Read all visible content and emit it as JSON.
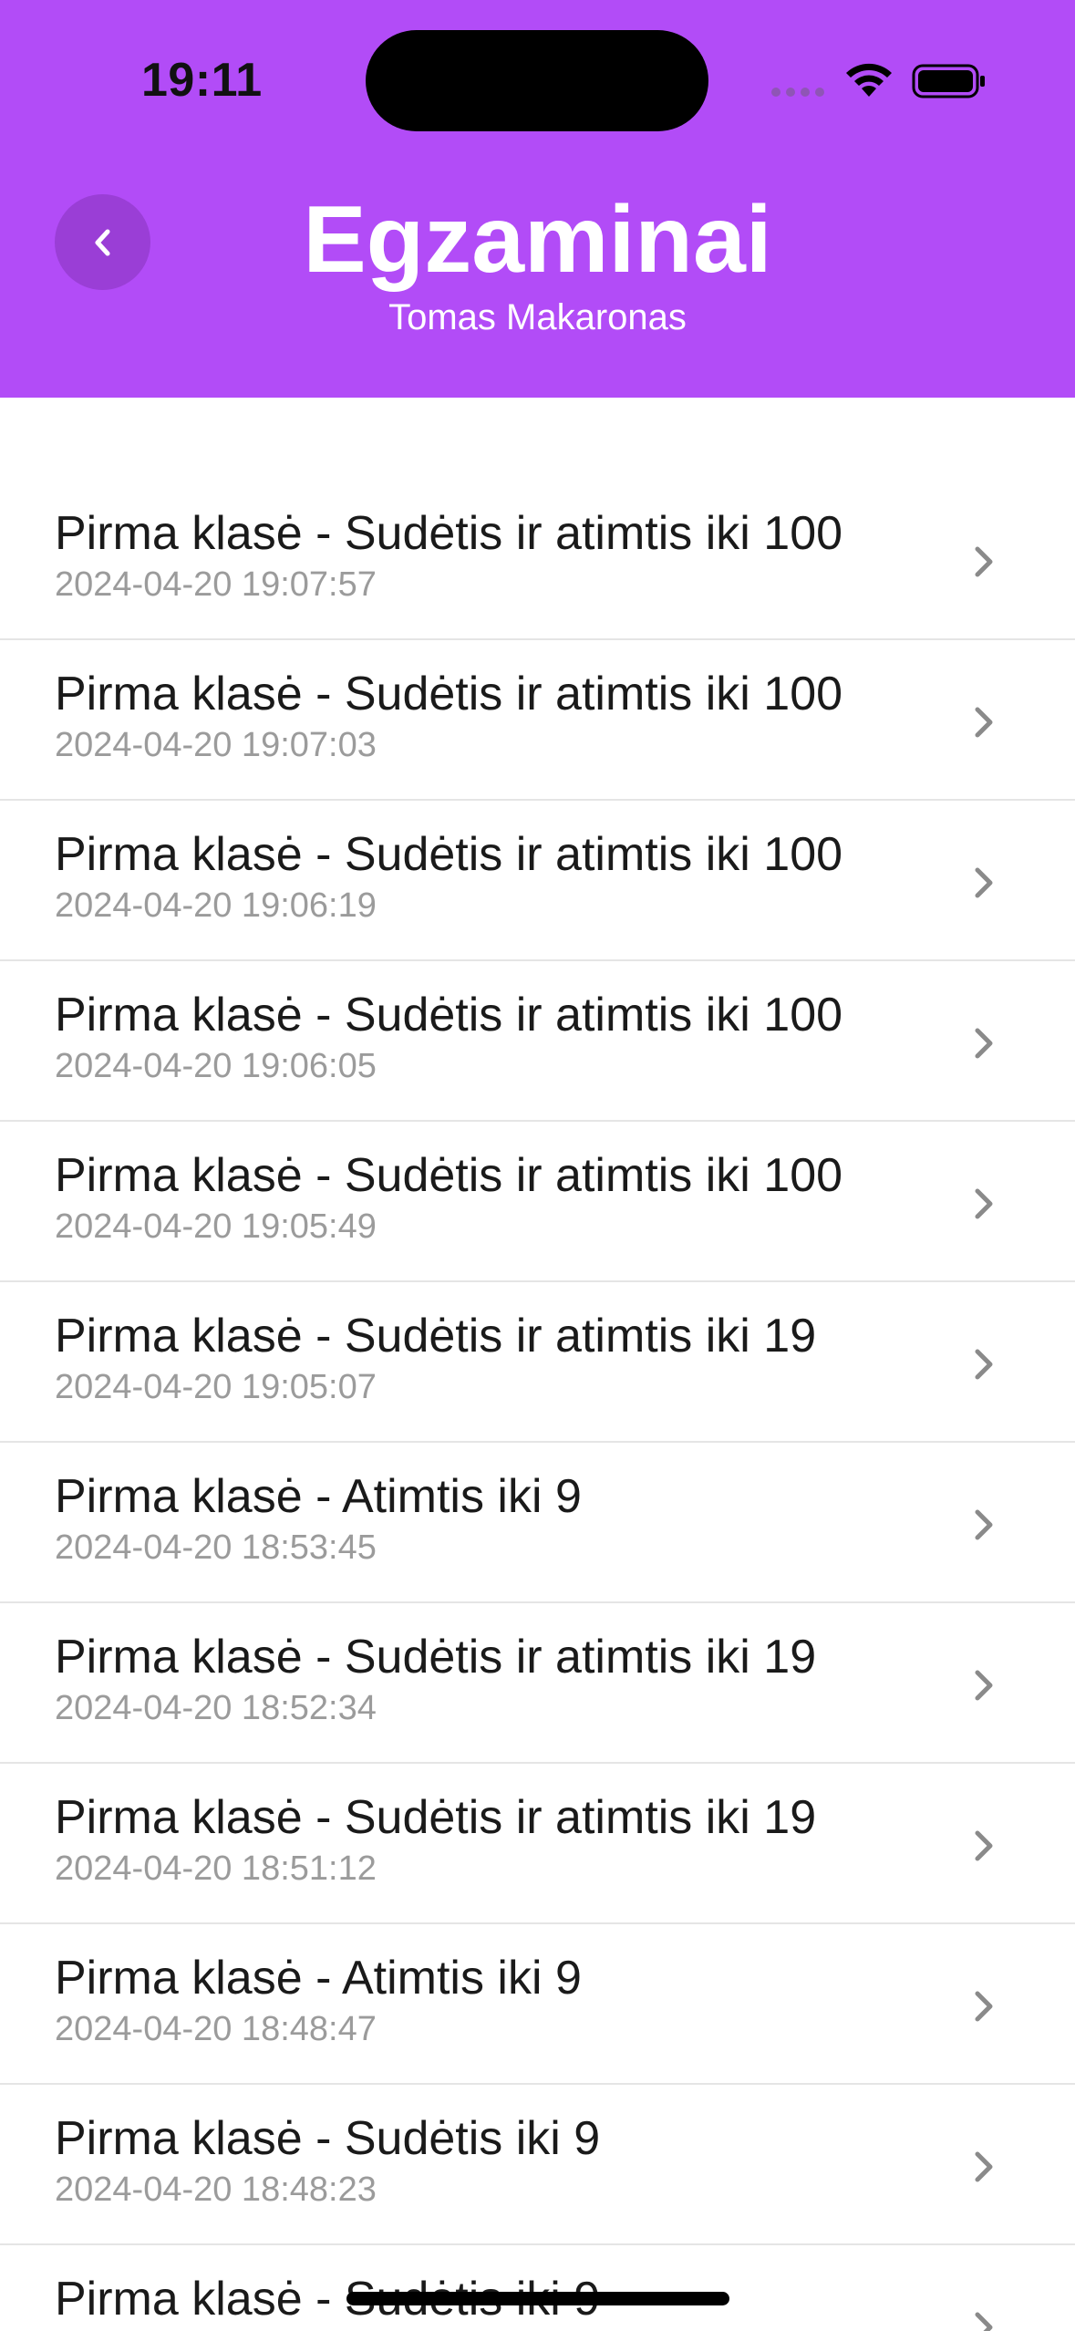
{
  "status_bar": {
    "time": "19:11"
  },
  "header": {
    "title": "Egzaminai",
    "subtitle": "Tomas Makaronas",
    "background_color": "#B24CF7",
    "back_icon": "chevron-left-icon"
  },
  "exams": [
    {
      "title": "Pirma klasė - Sudėtis ir atimtis iki 100",
      "date": "2024-04-20 19:07:57"
    },
    {
      "title": "Pirma klasė - Sudėtis ir atimtis iki 100",
      "date": "2024-04-20 19:07:03"
    },
    {
      "title": "Pirma klasė - Sudėtis ir atimtis iki 100",
      "date": "2024-04-20 19:06:19"
    },
    {
      "title": "Pirma klasė - Sudėtis ir atimtis iki 100",
      "date": "2024-04-20 19:06:05"
    },
    {
      "title": "Pirma klasė - Sudėtis ir atimtis iki 100",
      "date": "2024-04-20 19:05:49"
    },
    {
      "title": "Pirma klasė - Sudėtis ir atimtis iki 19",
      "date": "2024-04-20 19:05:07"
    },
    {
      "title": "Pirma klasė - Atimtis iki 9",
      "date": "2024-04-20 18:53:45"
    },
    {
      "title": "Pirma klasė - Sudėtis ir atimtis iki 19",
      "date": "2024-04-20 18:52:34"
    },
    {
      "title": "Pirma klasė - Sudėtis ir atimtis iki 19",
      "date": "2024-04-20 18:51:12"
    },
    {
      "title": "Pirma klasė - Atimtis iki 9",
      "date": "2024-04-20 18:48:47"
    },
    {
      "title": "Pirma klasė - Sudėtis iki 9",
      "date": "2024-04-20 18:48:23"
    },
    {
      "title": "Pirma klasė - Sudėtis iki 9",
      "date": ""
    }
  ]
}
